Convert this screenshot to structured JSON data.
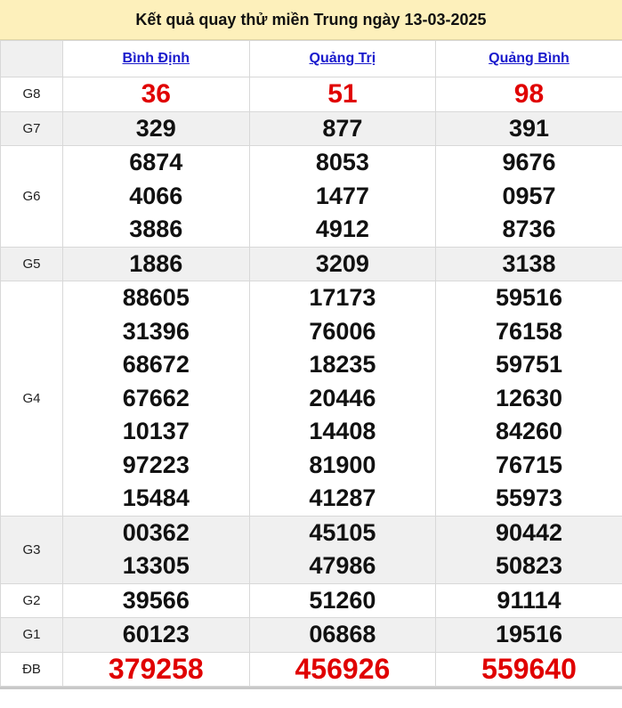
{
  "title": "Kết quả quay thử miền Trung ngày 13-03-2025",
  "provinces": [
    "Bình Định",
    "Quảng Trị",
    "Quảng Bình"
  ],
  "prizes": [
    {
      "label": "G8",
      "style": "red",
      "values": [
        [
          "36"
        ],
        [
          "51"
        ],
        [
          "98"
        ]
      ]
    },
    {
      "label": "G7",
      "style": "normal",
      "values": [
        [
          "329"
        ],
        [
          "877"
        ],
        [
          "391"
        ]
      ]
    },
    {
      "label": "G6",
      "style": "normal",
      "values": [
        [
          "6874",
          "4066",
          "3886"
        ],
        [
          "8053",
          "1477",
          "4912"
        ],
        [
          "9676",
          "0957",
          "8736"
        ]
      ]
    },
    {
      "label": "G5",
      "style": "normal",
      "values": [
        [
          "1886"
        ],
        [
          "3209"
        ],
        [
          "3138"
        ]
      ]
    },
    {
      "label": "G4",
      "style": "normal",
      "values": [
        [
          "88605",
          "31396",
          "68672",
          "67662",
          "10137",
          "97223",
          "15484"
        ],
        [
          "17173",
          "76006",
          "18235",
          "20446",
          "14408",
          "81900",
          "41287"
        ],
        [
          "59516",
          "76158",
          "59751",
          "12630",
          "84260",
          "76715",
          "55973"
        ]
      ]
    },
    {
      "label": "G3",
      "style": "normal",
      "values": [
        [
          "00362",
          "13305"
        ],
        [
          "45105",
          "47986"
        ],
        [
          "90442",
          "50823"
        ]
      ]
    },
    {
      "label": "G2",
      "style": "normal",
      "values": [
        [
          "39566"
        ],
        [
          "51260"
        ],
        [
          "91114"
        ]
      ]
    },
    {
      "label": "G1",
      "style": "normal",
      "values": [
        [
          "60123"
        ],
        [
          "06868"
        ],
        [
          "19516"
        ]
      ]
    },
    {
      "label": "ĐB",
      "style": "big",
      "values": [
        [
          "379258"
        ],
        [
          "456926"
        ],
        [
          "559640"
        ]
      ]
    }
  ],
  "colors": {
    "title_bg": "#fdf0bb",
    "link": "#1a1acc",
    "red": "#e00000",
    "stripe": "#f0f0f0"
  }
}
